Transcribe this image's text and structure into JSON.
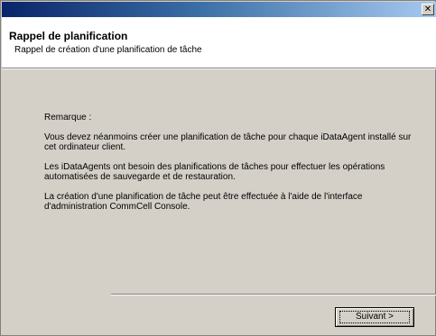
{
  "window": {
    "close_label": "✕"
  },
  "header": {
    "title": "Rappel de planification",
    "subtitle": "Rappel de création d'une planification de tâche"
  },
  "content": {
    "note_label": "Remarque :",
    "paragraphs": [
      "Vous devez néanmoins créer une planification de tâche pour chaque iDataAgent installé sur cet ordinateur client.",
      "Les iDataAgents ont besoin des planifications de tâches pour effectuer les opérations automatisées de sauvegarde et de restauration.",
      "La création d'une planification de tâche peut être effectuée à l'aide de l'interface d'administration CommCell Console."
    ]
  },
  "footer": {
    "next_label": "Suivant >"
  }
}
